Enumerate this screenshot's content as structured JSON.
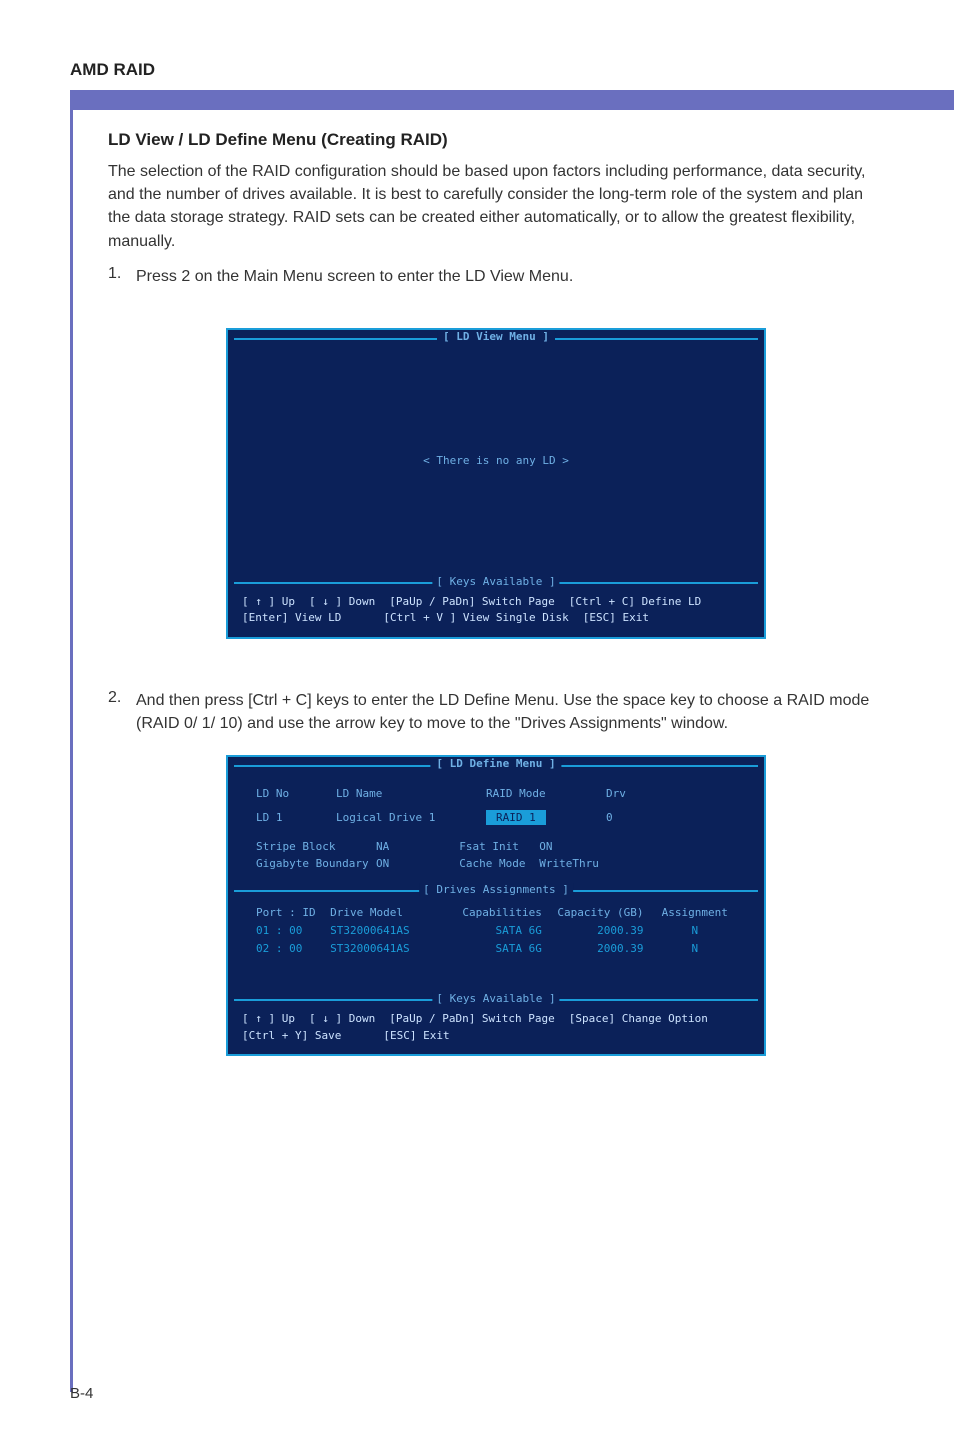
{
  "header": {
    "title": "AMD RAID"
  },
  "section": {
    "title": "LD View / LD Define Menu (Creating RAID)",
    "intro": "The selection of the RAID configuration should be based upon factors including performance, data security, and the number of drives available. It is best to carefully consider the long-term role of the system and plan the data storage strategy. RAID sets can be created either automatically, or to allow the greatest flexibility, manually."
  },
  "steps": [
    {
      "num": "1.",
      "text": "Press 2 on the Main Menu screen to enter the LD View Menu."
    },
    {
      "num": "2.",
      "text": "And then press [Ctrl + C] keys to enter the LD Define Menu. Use the space key to choose a RAID mode (RAID 0/ 1/ 10) and use the arrow key to move to the \"Drives Assignments\" window."
    }
  ],
  "ld_view": {
    "title": "[  LD View Menu  ]",
    "center_text": "< There is no any LD >",
    "keys_label": "[ Keys Available ]",
    "footer": {
      "row1": {
        "up": "[ ↑ ] Up",
        "down": "[ ↓ ] Down",
        "switch": "[PaUp / PaDn] Switch Page",
        "define": "[Ctrl + C] Define LD"
      },
      "row2": {
        "enter": "[Enter] View LD",
        "single": "[Ctrl + V ] View Single Disk",
        "esc": "[ESC] Exit"
      }
    }
  },
  "ld_define": {
    "title": "[  LD Define Menu  ]",
    "headers": {
      "ld_no": "LD No",
      "ld_name": "LD Name",
      "raid_mode": "RAID Mode",
      "drv": "Drv"
    },
    "row": {
      "ld": "LD   1",
      "name": "Logical Drive 1",
      "raid": "RAID 1",
      "drv": "0"
    },
    "settings_left": {
      "stripe_block_label": "Stripe Block",
      "stripe_block_value": "NA",
      "gb_boundary_label": "Gigabyte Boundary",
      "gb_boundary_value": "ON"
    },
    "settings_right": {
      "fast_init_label": "Fsat Init",
      "fast_init_value": "ON",
      "cache_mode_label": "Cache Mode",
      "cache_mode_value": "WriteThru"
    },
    "drives_label": "[  Drives Assignments  ]",
    "drives_header": {
      "port": "Port  : ID",
      "model": "Drive Model",
      "cap": "Capabilities",
      "capacity": "Capacity (GB)",
      "assign": "Assignment"
    },
    "drives": [
      {
        "port": "01 : 00",
        "model": "ST32000641AS",
        "cap": "SATA 6G",
        "capacity": "2000.39",
        "assign": "N"
      },
      {
        "port": "02 : 00",
        "model": "ST32000641AS",
        "cap": "SATA 6G",
        "capacity": "2000.39",
        "assign": "N"
      }
    ],
    "keys_label": "[ Keys Available ]",
    "footer": {
      "row1": {
        "up": "[ ↑ ] Up",
        "down": "[ ↓ ] Down",
        "switch": "[PaUp / PaDn] Switch Page",
        "change": "[Space] Change Option"
      },
      "row2": {
        "save": "[Ctrl + Y] Save",
        "esc": "[ESC] Exit"
      }
    }
  },
  "page_number": "B-4"
}
